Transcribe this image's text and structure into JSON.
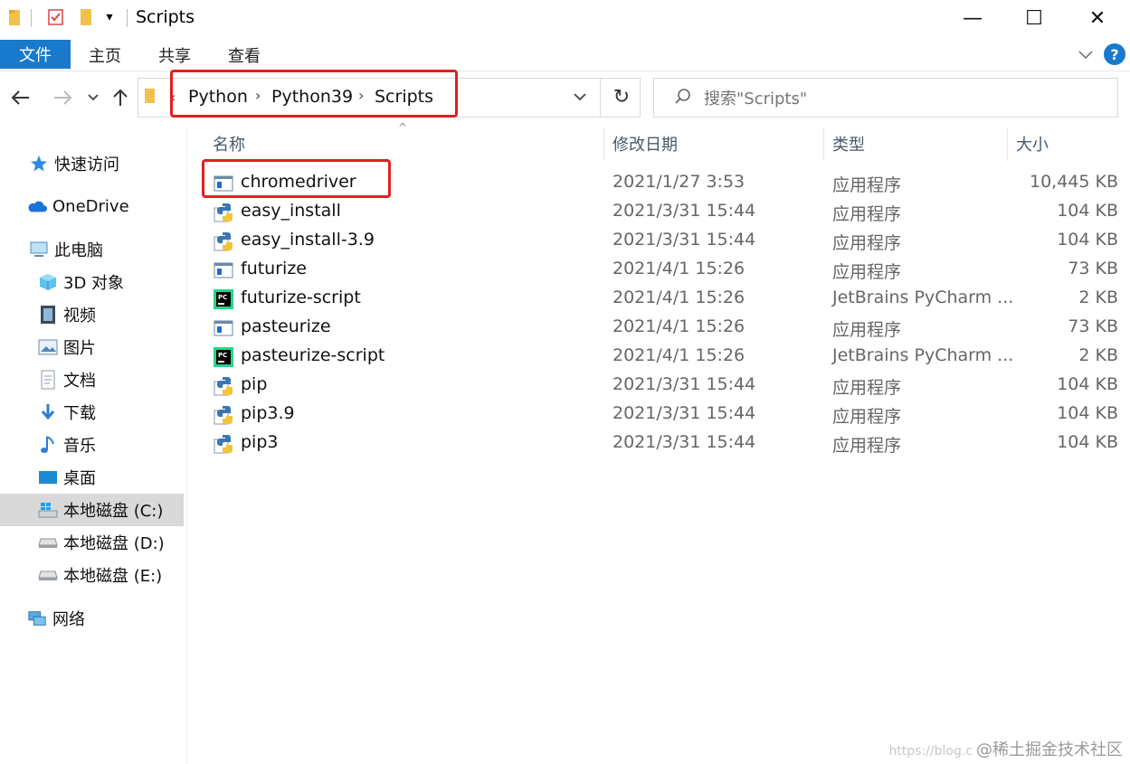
{
  "window": {
    "title": "Scripts"
  },
  "title_controls": {
    "minimize": "—",
    "maximize": "☐",
    "close": "✕"
  },
  "ribbon": {
    "tabs": [
      "文件",
      "主页",
      "共享",
      "查看"
    ],
    "help": "?"
  },
  "address_bar": {
    "overflow": "‹",
    "breadcrumbs": [
      "Python",
      "Python39",
      "Scripts"
    ],
    "separator": "›",
    "dropdown": "⌄",
    "refresh": "↻"
  },
  "search": {
    "placeholder": "搜索\"Scripts\"",
    "icon": "search-icon"
  },
  "sidebar": {
    "items": [
      {
        "label": "快速访问",
        "icon": "star-icon"
      },
      {
        "label": "OneDrive",
        "icon": "cloud-icon"
      },
      {
        "label": "此电脑",
        "icon": "computer-icon"
      },
      {
        "label": "3D 对象",
        "icon": "cube-icon"
      },
      {
        "label": "视频",
        "icon": "film-icon"
      },
      {
        "label": "图片",
        "icon": "picture-icon"
      },
      {
        "label": "文档",
        "icon": "document-icon"
      },
      {
        "label": "下载",
        "icon": "download-icon"
      },
      {
        "label": "音乐",
        "icon": "music-icon"
      },
      {
        "label": "桌面",
        "icon": "desktop-icon"
      },
      {
        "label": "本地磁盘 (C:)",
        "icon": "windows-drive-icon",
        "selected": true
      },
      {
        "label": "本地磁盘 (D:)",
        "icon": "drive-icon"
      },
      {
        "label": "本地磁盘 (E:)",
        "icon": "drive-icon"
      },
      {
        "label": "网络",
        "icon": "network-icon"
      }
    ]
  },
  "columns": {
    "name": "名称",
    "date": "修改日期",
    "type": "类型",
    "size": "大小",
    "sort_indicator": "^"
  },
  "files": [
    {
      "name": "chromedriver",
      "date": "2021/1/27 3:53",
      "type": "应用程序",
      "size": "10,445 KB",
      "icon": "exe-icon"
    },
    {
      "name": "easy_install",
      "date": "2021/3/31 15:44",
      "type": "应用程序",
      "size": "104 KB",
      "icon": "python-exe-icon"
    },
    {
      "name": "easy_install-3.9",
      "date": "2021/3/31 15:44",
      "type": "应用程序",
      "size": "104 KB",
      "icon": "python-exe-icon"
    },
    {
      "name": "futurize",
      "date": "2021/4/1 15:26",
      "type": "应用程序",
      "size": "73 KB",
      "icon": "exe-icon"
    },
    {
      "name": "futurize-script",
      "date": "2021/4/1 15:26",
      "type": "JetBrains PyCharm ...",
      "size": "2 KB",
      "icon": "pycharm-icon"
    },
    {
      "name": "pasteurize",
      "date": "2021/4/1 15:26",
      "type": "应用程序",
      "size": "73 KB",
      "icon": "exe-icon"
    },
    {
      "name": "pasteurize-script",
      "date": "2021/4/1 15:26",
      "type": "JetBrains PyCharm ...",
      "size": "2 KB",
      "icon": "pycharm-icon"
    },
    {
      "name": "pip",
      "date": "2021/3/31 15:44",
      "type": "应用程序",
      "size": "104 KB",
      "icon": "python-exe-icon"
    },
    {
      "name": "pip3.9",
      "date": "2021/3/31 15:44",
      "type": "应用程序",
      "size": "104 KB",
      "icon": "python-exe-icon"
    },
    {
      "name": "pip3",
      "date": "2021/3/31 15:44",
      "type": "应用程序",
      "size": "104 KB",
      "icon": "python-exe-icon"
    }
  ],
  "watermark": {
    "url": "https://blog.c",
    "text": "@稀土掘金技术社区"
  },
  "colors": {
    "accent": "#1979ca",
    "highlight": "#e02020",
    "selected": "#d9d9d9"
  }
}
